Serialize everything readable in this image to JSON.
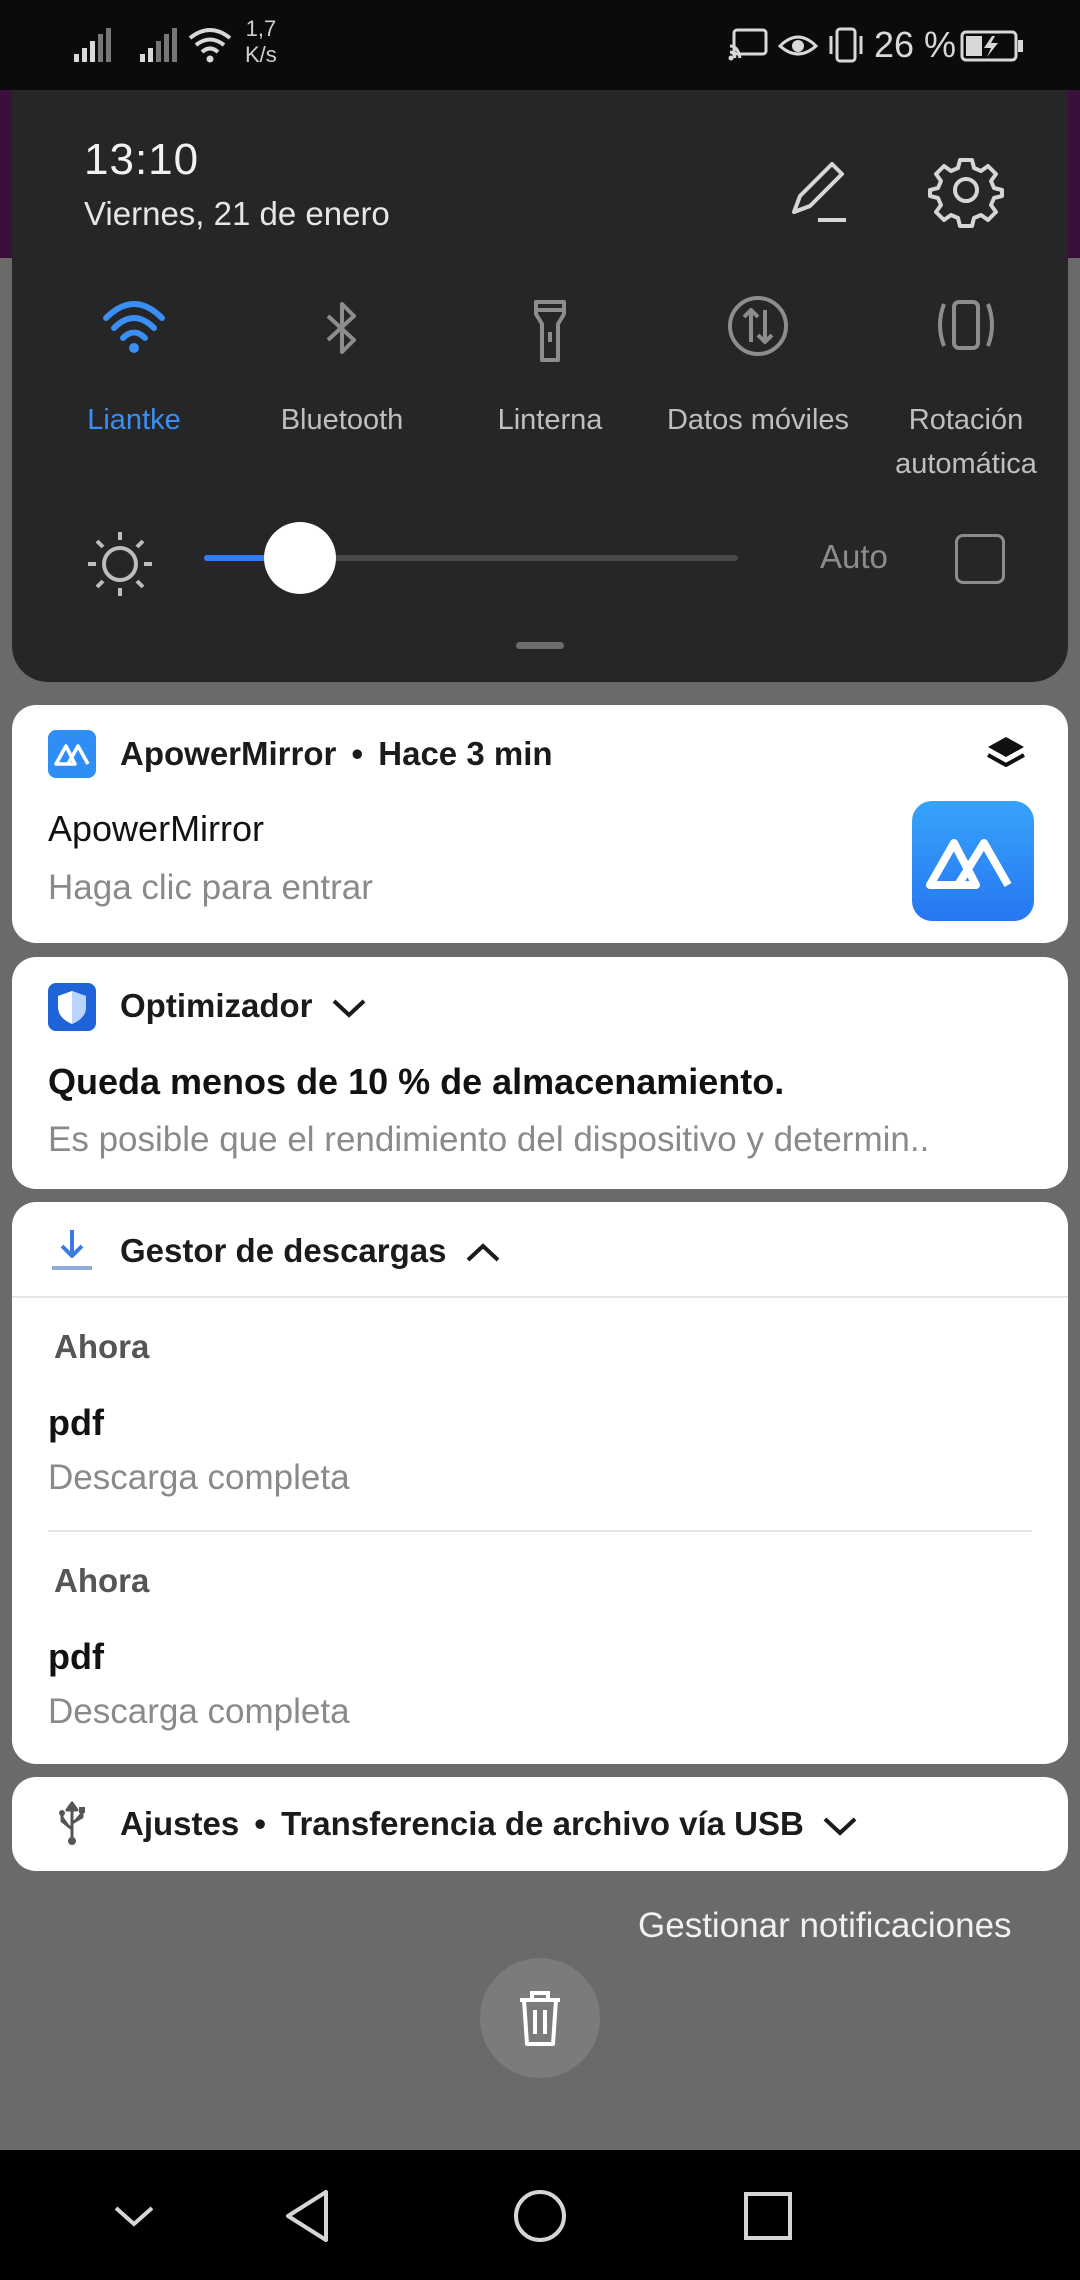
{
  "status_bar": {
    "net_speed_value": "1,7",
    "net_speed_unit": "K/s",
    "battery_percent": "26 %"
  },
  "quick_settings": {
    "time": "13:10",
    "date": "Viernes, 21 de enero",
    "tiles": [
      {
        "label": "Liantke",
        "icon": "wifi-icon",
        "active": true
      },
      {
        "label": "Bluetooth",
        "icon": "bluetooth-icon",
        "active": false
      },
      {
        "label": "Linterna",
        "icon": "flashlight-icon",
        "active": false
      },
      {
        "label": "Datos móviles",
        "icon": "mobile-data-icon",
        "active": false
      },
      {
        "label": "Rotación automática",
        "icon": "auto-rotate-icon",
        "active": false
      }
    ],
    "brightness": {
      "level": 0.18,
      "auto_label": "Auto",
      "auto_checked": false
    },
    "accent_color": "#2f7ef5"
  },
  "notifications": {
    "apowermirror": {
      "app_name": "ApowerMirror",
      "separator": "•",
      "time": "Hace 3 min",
      "title": "ApowerMirror",
      "text": "Haga clic para entrar"
    },
    "optimizer": {
      "app_name": "Optimizador",
      "title": "Queda menos de 10 % de almacenamiento.",
      "text": "Es posible que el rendimiento del dispositivo y determin.."
    },
    "downloads": {
      "app_name": "Gestor de descargas",
      "items": [
        {
          "time": "Ahora",
          "title": "pdf",
          "text": "Descarga completa"
        },
        {
          "time": "Ahora",
          "title": "pdf",
          "text": "Descarga completa"
        }
      ]
    },
    "usb": {
      "app_name": "Ajustes",
      "separator": "•",
      "text": "Transferencia de archivo vía USB"
    }
  },
  "manage_label": "Gestionar notificaciones"
}
